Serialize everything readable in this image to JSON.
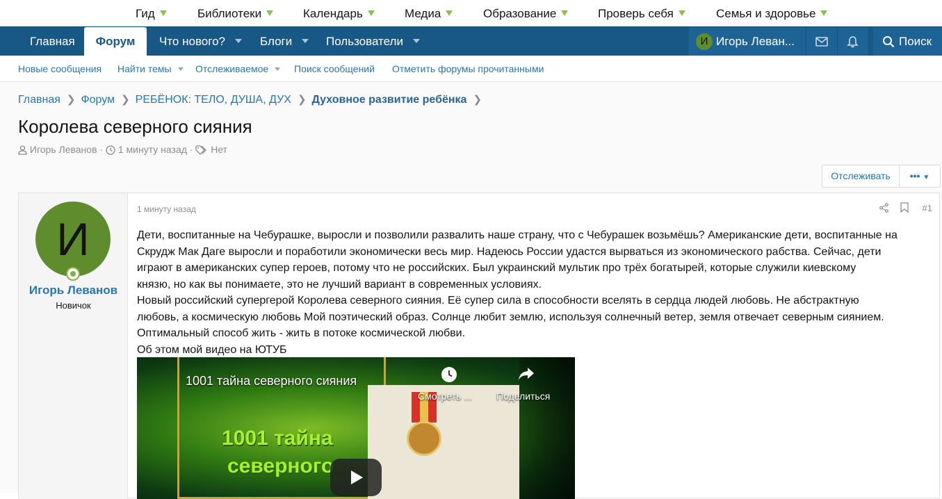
{
  "topbar": {
    "items": [
      "Гид",
      "Библиотеки",
      "Календарь",
      "Медиа",
      "Образование",
      "Проверь себя",
      "Семья и здоровье"
    ],
    "accent": "#8cc04b"
  },
  "nav": {
    "home": "Главная",
    "forum": "Форум",
    "whats_new": "Что нового?",
    "blogs": "Блоги",
    "users": "Пользователи",
    "user_initial": "И",
    "user_name": "Игорь Леван...",
    "search": "Поиск",
    "color": "#185886"
  },
  "subnav": {
    "items": [
      "Новые сообщения",
      "Найти темы",
      "Отслеживаемое",
      "Поиск сообщений",
      "Отметить форумы прочитанными"
    ]
  },
  "breadcrumb": [
    "Главная",
    "Форум",
    "РЕБЁНОК: ТЕЛО, ДУША, ДУХ",
    "Духовное развитие ребёнка"
  ],
  "thread": {
    "title": "Королева северного сияния",
    "author": "Игорь Леванов",
    "time": "1 минуту назад",
    "tags": "Нет",
    "watch_label": "Отслеживать",
    "more_label": "•••"
  },
  "post": {
    "avatar_letter": "И",
    "author": "Игорь Леванов",
    "role": "Новичок",
    "time": "1 минуту назад",
    "number": "#1",
    "lines": [
      "Дети, воспитанные на Чебурашке, выросли и позволили развалить наше страну, что с Чебурашек возьмёшь? Американские дети, воспитанные на",
      "Скрудж Мак Даге выросли и поработили экономически весь мир. Надеюсь России удастся вырваться из экономического рабства. Сейчас, дети",
      "играют в американских супер героев, потому что не российских. Был украинский мультик про трёх богатырей, которые служили киевскому",
      "князю, но как вы понимаете, это не лучший вариант в современных условиях.",
      "Новый российский супергерой Королева северного сияния. Её супер сила в способности вселять в сердца людей любовь. Не абстрактную",
      "любовь, а космическую любовь Мой поэтический образ. Солнце любит землю, используя солнечный ветер, земля отвечает северным сиянием.",
      "Оптимальный способ жить - жить в потоке космической любви.",
      "Об этом мой видео на ЮТУБ"
    ]
  },
  "video": {
    "title": "1001 тайна северного сияния",
    "watch_later": "Смотреть ...",
    "share": "Поделиться",
    "overlay_line1": "1001 тайна",
    "overlay_line2": "северного"
  }
}
